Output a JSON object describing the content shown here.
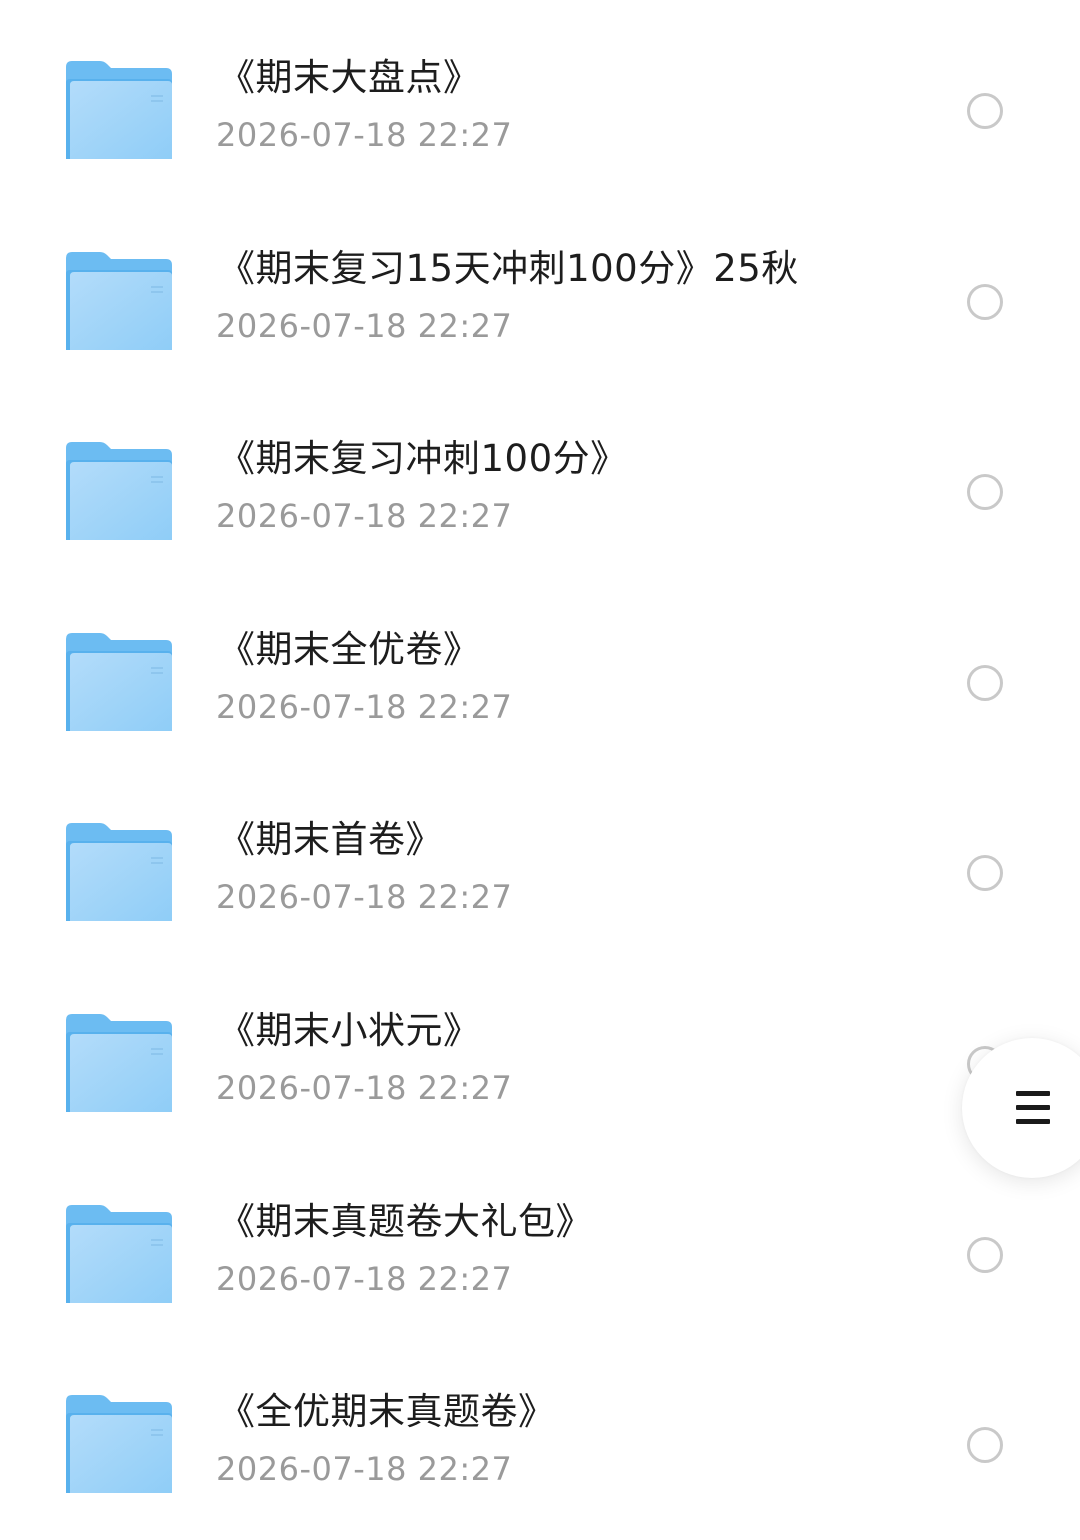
{
  "file_list": {
    "items": [
      {
        "name": "《期末大盘点》",
        "date": "2026-07-18 22:27",
        "icon": "folder-icon",
        "selected": false
      },
      {
        "name": "《期末复习15天冲刺100分》25秋",
        "date": "2026-07-18 22:27",
        "icon": "folder-icon",
        "selected": false
      },
      {
        "name": "《期末复习冲刺100分》",
        "date": "2026-07-18 22:27",
        "icon": "folder-icon",
        "selected": false
      },
      {
        "name": "《期末全优卷》",
        "date": "2026-07-18 22:27",
        "icon": "folder-icon",
        "selected": false
      },
      {
        "name": "《期末首卷》",
        "date": "2026-07-18 22:27",
        "icon": "folder-icon",
        "selected": false
      },
      {
        "name": "《期末小状元》",
        "date": "2026-07-18 22:27",
        "icon": "folder-icon",
        "selected": false
      },
      {
        "name": "《期末真题卷大礼包》",
        "date": "2026-07-18 22:27",
        "icon": "folder-icon",
        "selected": false
      },
      {
        "name": "《全优期末真题卷》",
        "date": "2026-07-18 22:27",
        "icon": "folder-icon",
        "selected": false
      }
    ]
  },
  "floating_menu": {
    "icon": "menu-icon"
  },
  "colors": {
    "folder_light": "#b3dcfa",
    "folder_dark": "#6cbcf2",
    "text_primary": "#1d1d1d",
    "text_secondary": "#9a9a9a",
    "radio_border": "#c9c9c9"
  }
}
